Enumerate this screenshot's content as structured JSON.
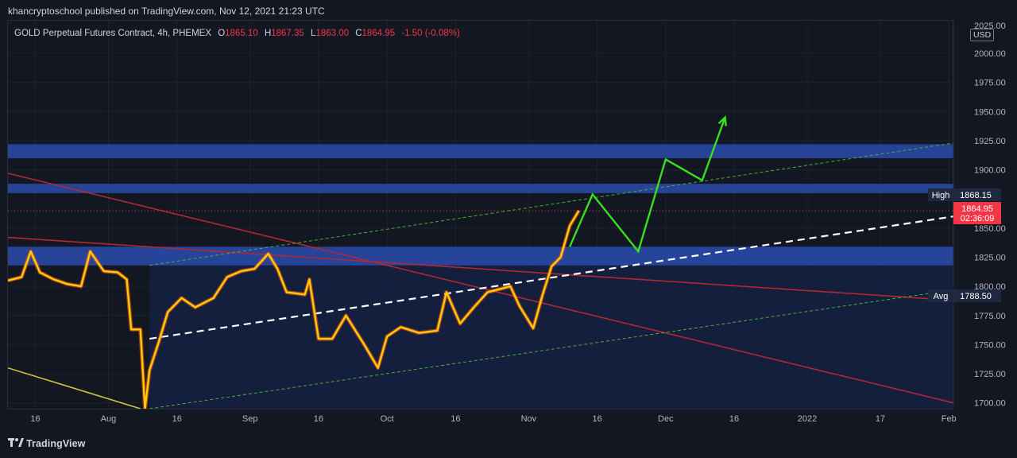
{
  "header": {
    "publisher_line": "khancryptoschool published on TradingView.com, Nov 12, 2021 21:23 UTC"
  },
  "legend": {
    "symbol": "GOLD Perpetual Futures Contract, 4h, PHEMEX",
    "open_label": "O",
    "open": "1865.10",
    "high_label": "H",
    "high": "1867.35",
    "low_label": "L",
    "low": "1863.00",
    "close_label": "C",
    "close": "1864.95",
    "change": "-1.50 (-0.08%)"
  },
  "price_axis": {
    "currency": "USD",
    "top_partial_label": "2025.00",
    "labels": [
      "2000.00",
      "1975.00",
      "1950.00",
      "1925.00",
      "1900.00",
      "1850.00",
      "1825.00",
      "1800.00",
      "1775.00",
      "1750.00",
      "1725.00",
      "1700.00"
    ]
  },
  "markers": {
    "high": {
      "label": "High",
      "value": "1868.15"
    },
    "last": {
      "value": "1864.95",
      "countdown": "02:36:09"
    },
    "avg": {
      "label": "Avg",
      "value": "1788.50"
    }
  },
  "time_axis": {
    "labels": [
      "16",
      "Aug",
      "16",
      "Sep",
      "16",
      "Oct",
      "16",
      "Nov",
      "16",
      "Dec",
      "16",
      "2022",
      "17",
      "Feb"
    ]
  },
  "footer": {
    "brand": "TradingView"
  },
  "colors": {
    "background": "#131722",
    "grid": "#1e222d",
    "candle": "#ffcc00",
    "candle_wick": "#ff5a1f",
    "resistance_zone": "#2a4bab",
    "channel_fill": "#152042",
    "red_trendline": "#b22833",
    "yellow_trendline": "#d4c43a",
    "green_projection": "#39e01c",
    "green_dashed": "#4caf32",
    "white_dashed": "#ffffff",
    "last_price_badge": "#f23645",
    "marker_badge": "#1e2940"
  },
  "chart_data": {
    "type": "line",
    "title": "GOLD Perpetual Futures Contract, 4h, PHEMEX",
    "ylim": [
      1695,
      2028
    ],
    "x_range": [
      "2021-07-10",
      "2022-02-02"
    ],
    "x_ticks": [
      {
        "label": "16",
        "date": "2021-07-16"
      },
      {
        "label": "Aug",
        "date": "2021-08-01"
      },
      {
        "label": "16",
        "date": "2021-08-16"
      },
      {
        "label": "Sep",
        "date": "2021-09-01"
      },
      {
        "label": "16",
        "date": "2021-09-16"
      },
      {
        "label": "Oct",
        "date": "2021-10-01"
      },
      {
        "label": "16",
        "date": "2021-10-16"
      },
      {
        "label": "Nov",
        "date": "2021-11-01"
      },
      {
        "label": "16",
        "date": "2021-11-16"
      },
      {
        "label": "Dec",
        "date": "2021-12-01"
      },
      {
        "label": "16",
        "date": "2021-12-16"
      },
      {
        "label": "2022",
        "date": "2022-01-01"
      },
      {
        "label": "17",
        "date": "2022-01-17"
      },
      {
        "label": "Feb",
        "date": "2022-02-01"
      }
    ],
    "y_ticks": [
      1700,
      1725,
      1750,
      1775,
      1800,
      1825,
      1850,
      1900,
      1925,
      1950,
      1975,
      2000
    ],
    "price_path": [
      [
        "2021-07-10",
        1805
      ],
      [
        "2021-07-13",
        1808
      ],
      [
        "2021-07-15",
        1830
      ],
      [
        "2021-07-17",
        1812
      ],
      [
        "2021-07-20",
        1806
      ],
      [
        "2021-07-23",
        1802
      ],
      [
        "2021-07-26",
        1800
      ],
      [
        "2021-07-28",
        1830
      ],
      [
        "2021-07-31",
        1813
      ],
      [
        "2021-08-03",
        1812
      ],
      [
        "2021-08-05",
        1806
      ],
      [
        "2021-08-06",
        1763
      ],
      [
        "2021-08-08",
        1763
      ],
      [
        "2021-08-09",
        1695
      ],
      [
        "2021-08-10",
        1728
      ],
      [
        "2021-08-12",
        1752
      ],
      [
        "2021-08-14",
        1778
      ],
      [
        "2021-08-17",
        1790
      ],
      [
        "2021-08-20",
        1782
      ],
      [
        "2021-08-24",
        1790
      ],
      [
        "2021-08-27",
        1808
      ],
      [
        "2021-08-30",
        1813
      ],
      [
        "2021-09-02",
        1815
      ],
      [
        "2021-09-05",
        1828
      ],
      [
        "2021-09-07",
        1815
      ],
      [
        "2021-09-09",
        1795
      ],
      [
        "2021-09-13",
        1793
      ],
      [
        "2021-09-14",
        1806
      ],
      [
        "2021-09-16",
        1755
      ],
      [
        "2021-09-19",
        1755
      ],
      [
        "2021-09-22",
        1775
      ],
      [
        "2021-09-26",
        1750
      ],
      [
        "2021-09-29",
        1730
      ],
      [
        "2021-10-01",
        1757
      ],
      [
        "2021-10-04",
        1765
      ],
      [
        "2021-10-08",
        1760
      ],
      [
        "2021-10-12",
        1762
      ],
      [
        "2021-10-14",
        1795
      ],
      [
        "2021-10-17",
        1768
      ],
      [
        "2021-10-20",
        1782
      ],
      [
        "2021-10-23",
        1795
      ],
      [
        "2021-10-26",
        1798
      ],
      [
        "2021-10-28",
        1800
      ],
      [
        "2021-10-30",
        1783
      ],
      [
        "2021-11-02",
        1764
      ],
      [
        "2021-11-04",
        1792
      ],
      [
        "2021-11-06",
        1817
      ],
      [
        "2021-11-08",
        1825
      ],
      [
        "2021-11-10",
        1852
      ],
      [
        "2021-11-12",
        1865
      ]
    ],
    "zones": [
      {
        "name": "upper resistance",
        "from": 1910,
        "to": 1922
      },
      {
        "name": "mid resistance",
        "from": 1880,
        "to": 1888
      },
      {
        "name": "support",
        "from": 1818,
        "to": 1834
      }
    ],
    "channel_fill": {
      "from": 1695,
      "to": 1834,
      "start": "2021-08-10"
    },
    "trendlines": [
      {
        "kind": "red",
        "points": [
          [
            "2021-07-10",
            1897
          ],
          [
            "2022-02-02",
            1700
          ]
        ]
      },
      {
        "kind": "red",
        "points": [
          [
            "2021-07-10",
            1842
          ],
          [
            "2022-02-02",
            1788
          ]
        ]
      },
      {
        "kind": "yellow",
        "points": [
          [
            "2021-07-10",
            1730
          ],
          [
            "2021-08-08",
            1695
          ]
        ]
      },
      {
        "kind": "green-dashed",
        "points": [
          [
            "2021-08-10",
            1818
          ],
          [
            "2022-02-02",
            1923
          ]
        ]
      },
      {
        "kind": "green-dashed",
        "points": [
          [
            "2021-08-10",
            1695
          ],
          [
            "2022-02-02",
            1797
          ]
        ]
      },
      {
        "kind": "white-dashed",
        "points": [
          [
            "2021-08-10",
            1755
          ],
          [
            "2022-02-02",
            1860
          ]
        ]
      }
    ],
    "projection": [
      [
        "2021-11-10",
        1834
      ],
      [
        "2021-11-15",
        1879
      ],
      [
        "2021-11-25",
        1830
      ],
      [
        "2021-12-01",
        1909
      ],
      [
        "2021-12-09",
        1891
      ],
      [
        "2021-12-14",
        1945
      ]
    ],
    "horizontal_levels": [
      {
        "name": "last",
        "value": 1864.95,
        "style": "dotted"
      }
    ]
  }
}
